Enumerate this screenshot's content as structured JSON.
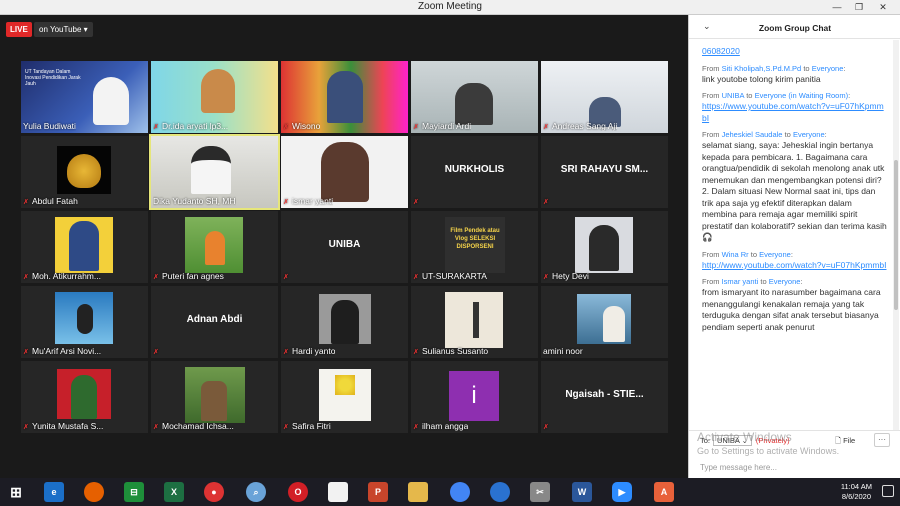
{
  "window": {
    "title": "Zoom Meeting"
  },
  "live": {
    "badge": "LIVE",
    "destination": "on YouTube"
  },
  "tiles": [
    "Yulia Budiwati",
    "Dr.ida aryati lp3...",
    "Wisono",
    "Mayiardi Ardi",
    "Andreas Sang Aji",
    "Abdul Fatah",
    "Dika Yudanto SH, MH",
    "ismar yanti",
    "",
    "",
    "Moh. Atikurrahm...",
    "Puteri fan agnes",
    "",
    "UT-SURAKARTA",
    "Hety Devi",
    "Mu'Arif Arsi Novi...",
    "",
    "Hardi yanto",
    "Sulianus Susanto",
    "amini noor",
    "Yunita Mustafa S...",
    "Mochamad Ichsa...",
    "Safira Fitri",
    "ilham angga",
    ""
  ],
  "big_names": {
    "t8": "NURKHOLIS",
    "t9": "SRI RAHAYU SM...",
    "t12": "UNIBA",
    "t16": "Adnan Abdi",
    "t24": "Ngaisah - STIE..."
  },
  "tile_texts": {
    "banner1": "UT Tandayan Dalam Inovasi Pendidikan Jarak Jauh",
    "poster": "Film Pendek atau Vlog SELEKSI DISPORSENI",
    "ilham_letter": "i"
  },
  "chat": {
    "title": "Zoom Group Chat",
    "top_line": "06082020",
    "messages": [
      {
        "from": "Siti Kholipah,S.Pd.M.Pd",
        "to": "Everyone",
        "text": "link youtobe tolong kirim panitia",
        "link": ""
      },
      {
        "from": "UNIBA",
        "to": "Everyone (in Waiting Room)",
        "text": "",
        "link": "https://www.youtube.com/watch?v=uF07hKpmmbI"
      },
      {
        "from": "Jeheskiel Saudale",
        "to": "Everyone",
        "text": "selamat siang, saya: Jeheskial ingin bertanya kepada para pembicara. 1. Bagaimana cara orangtua/pendidik di sekolah menolong anak utk menemukan dan mengembangkan potensi diri? 2. Dalam situasi New Normal saat ini, tips dan trik apa saja yg efektif diterapkan dalam membina para remaja agar memiliki spirit prestatif dan kolaboratif? sekian dan terima kasih 🎧",
        "link": ""
      },
      {
        "from": "Wina Rr",
        "to": "Everyone",
        "text": "",
        "link": "http://www.youtube.com/watch?v=uF07hKpmmbI"
      },
      {
        "from": "Ismar yanti",
        "to": "Everyone",
        "text": "from ismaryant ito narasumber bagaimana cara menanggulangi kenakalan remaja yang tak terduguka dengan sifat anak tersebut biasanya pendiam seperti anak penurut",
        "link": ""
      }
    ],
    "from_word": "From",
    "to_word": "to",
    "to_label": "To:",
    "to_value": "UNIBA",
    "private": "(Privately)",
    "file": "File",
    "placeholder": "Type message here..."
  },
  "watermark": {
    "line1": "Activate Windows",
    "line2": "Go to Settings to activate Windows."
  },
  "clock": {
    "time": "11:04 AM",
    "date": "8/6/2020"
  }
}
